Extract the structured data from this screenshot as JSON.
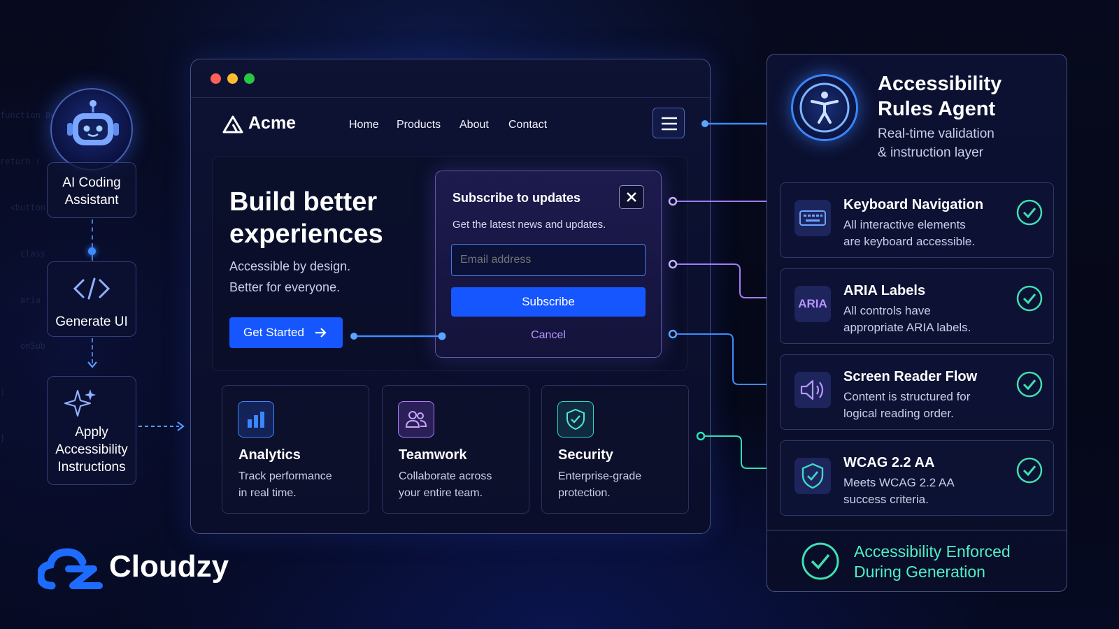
{
  "code_snippet": [
    "function Button",
    "return (",
    "  <button",
    "    class",
    "    aria",
    "    onSub",
    ")",
    "}"
  ],
  "pipeline": {
    "step1": {
      "line1": "AI Coding",
      "line2": "Assistant"
    },
    "step2": {
      "label": "Generate UI"
    },
    "step3": {
      "line1": "Apply",
      "line2": "Accessibility",
      "line3": "Instructions"
    }
  },
  "browser": {
    "brand": "Acme",
    "nav": [
      "Home",
      "Products",
      "About",
      "Contact"
    ],
    "hero": {
      "title_line1": "Build better",
      "title_line2": "experiences",
      "subtitle_line1": "Accessible by design.",
      "subtitle_line2": "Better for everyone.",
      "cta": "Get Started"
    },
    "modal": {
      "title": "Subscribe to updates",
      "desc": "Get the latest news and updates.",
      "email_placeholder": "Email address",
      "subscribe": "Subscribe",
      "cancel": "Cancel"
    },
    "features": [
      {
        "title": "Analytics",
        "line1": "Track performance",
        "line2": "in real time.",
        "icon": "bar-chart-icon",
        "color": "#3d86ff"
      },
      {
        "title": "Teamwork",
        "line1": "Collaborate across",
        "line2": "your entire team.",
        "icon": "users-icon",
        "color": "#b07cff"
      },
      {
        "title": "Security",
        "line1": "Enterprise-grade",
        "line2": "protection.",
        "icon": "shield-icon",
        "color": "#2fd6c4"
      }
    ]
  },
  "agent": {
    "title_line1": "Accessibility",
    "title_line2": "Rules Agent",
    "subtitle_line1": "Real-time validation",
    "subtitle_line2": "& instruction layer",
    "rules": [
      {
        "title": "Keyboard Navigation",
        "line1": "All interactive elements",
        "line2": "are keyboard accessible.",
        "icon": "keyboard-icon",
        "status": "passed"
      },
      {
        "title": "ARIA Labels",
        "line1": "All controls have",
        "line2": "appropriate ARIA labels.",
        "icon_text": "ARIA",
        "status": "passed"
      },
      {
        "title": "Screen Reader Flow",
        "line1": "Content is structured for",
        "line2": "logical reading order.",
        "icon": "speaker-icon",
        "status": "passed"
      },
      {
        "title": "WCAG 2.2 AA",
        "line1": "Meets WCAG 2.2 AA",
        "line2": "success criteria.",
        "icon": "shield-check-icon",
        "status": "passed"
      }
    ],
    "footer_line1": "Accessibility Enforced",
    "footer_line2": "During Generation"
  },
  "logo": {
    "text": "Cloudzy"
  },
  "colors": {
    "accent_blue": "#1656ff",
    "accent_purple": "#a78bfa",
    "accent_teal": "#2fe0b8",
    "check_teal": "#3fe0b0"
  }
}
